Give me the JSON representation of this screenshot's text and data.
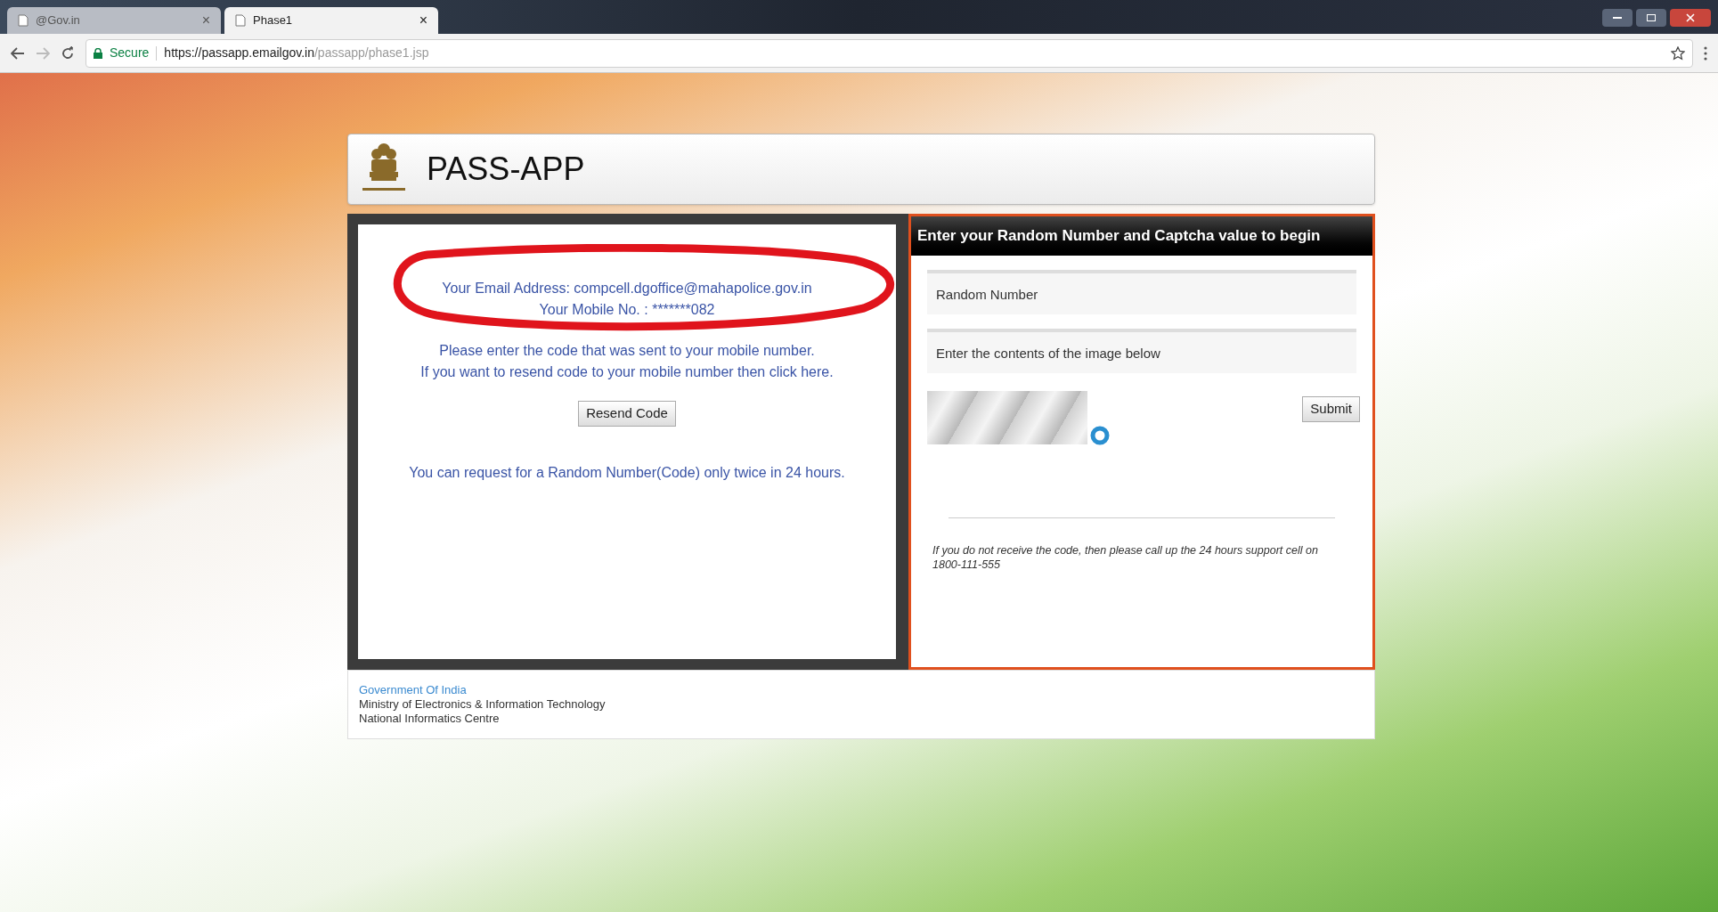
{
  "browser": {
    "tabs": [
      {
        "title": "@Gov.in",
        "close": "×",
        "selected": false
      },
      {
        "title": "Phase1",
        "close": "×",
        "selected": true
      }
    ],
    "address": {
      "secure_label": "Secure",
      "url_host": "https://passapp.emailgov.in",
      "url_path": "/passapp/phase1.jsp"
    }
  },
  "header": {
    "title": "PASS-APP"
  },
  "info": {
    "email_line": "Your Email Address: compcell.dgoffice@mahapolice.gov.in",
    "mobile_line": "Your Mobile No. : *******082",
    "instructions": [
      "Please enter the code that was sent to your mobile number.",
      "If you want to resend code to your mobile number then click here."
    ],
    "resend_button": "Resend Code",
    "limit_note": "You can request for a Random Number(Code) only twice in 24 hours."
  },
  "form": {
    "heading": "Enter your Random Number and Captcha value to begin",
    "fields": [
      {
        "placeholder": "Random Number"
      },
      {
        "placeholder": "Enter the contents of the image below"
      }
    ],
    "submit_button": "Submit",
    "support_note": "If you do not receive the code, then please call up the 24 hours support cell on 1800-111-555"
  },
  "footer": {
    "organisation": "Government Of India",
    "lines": [
      "Ministry of Electronics & Information Technology",
      "National Informatics Centre"
    ]
  }
}
